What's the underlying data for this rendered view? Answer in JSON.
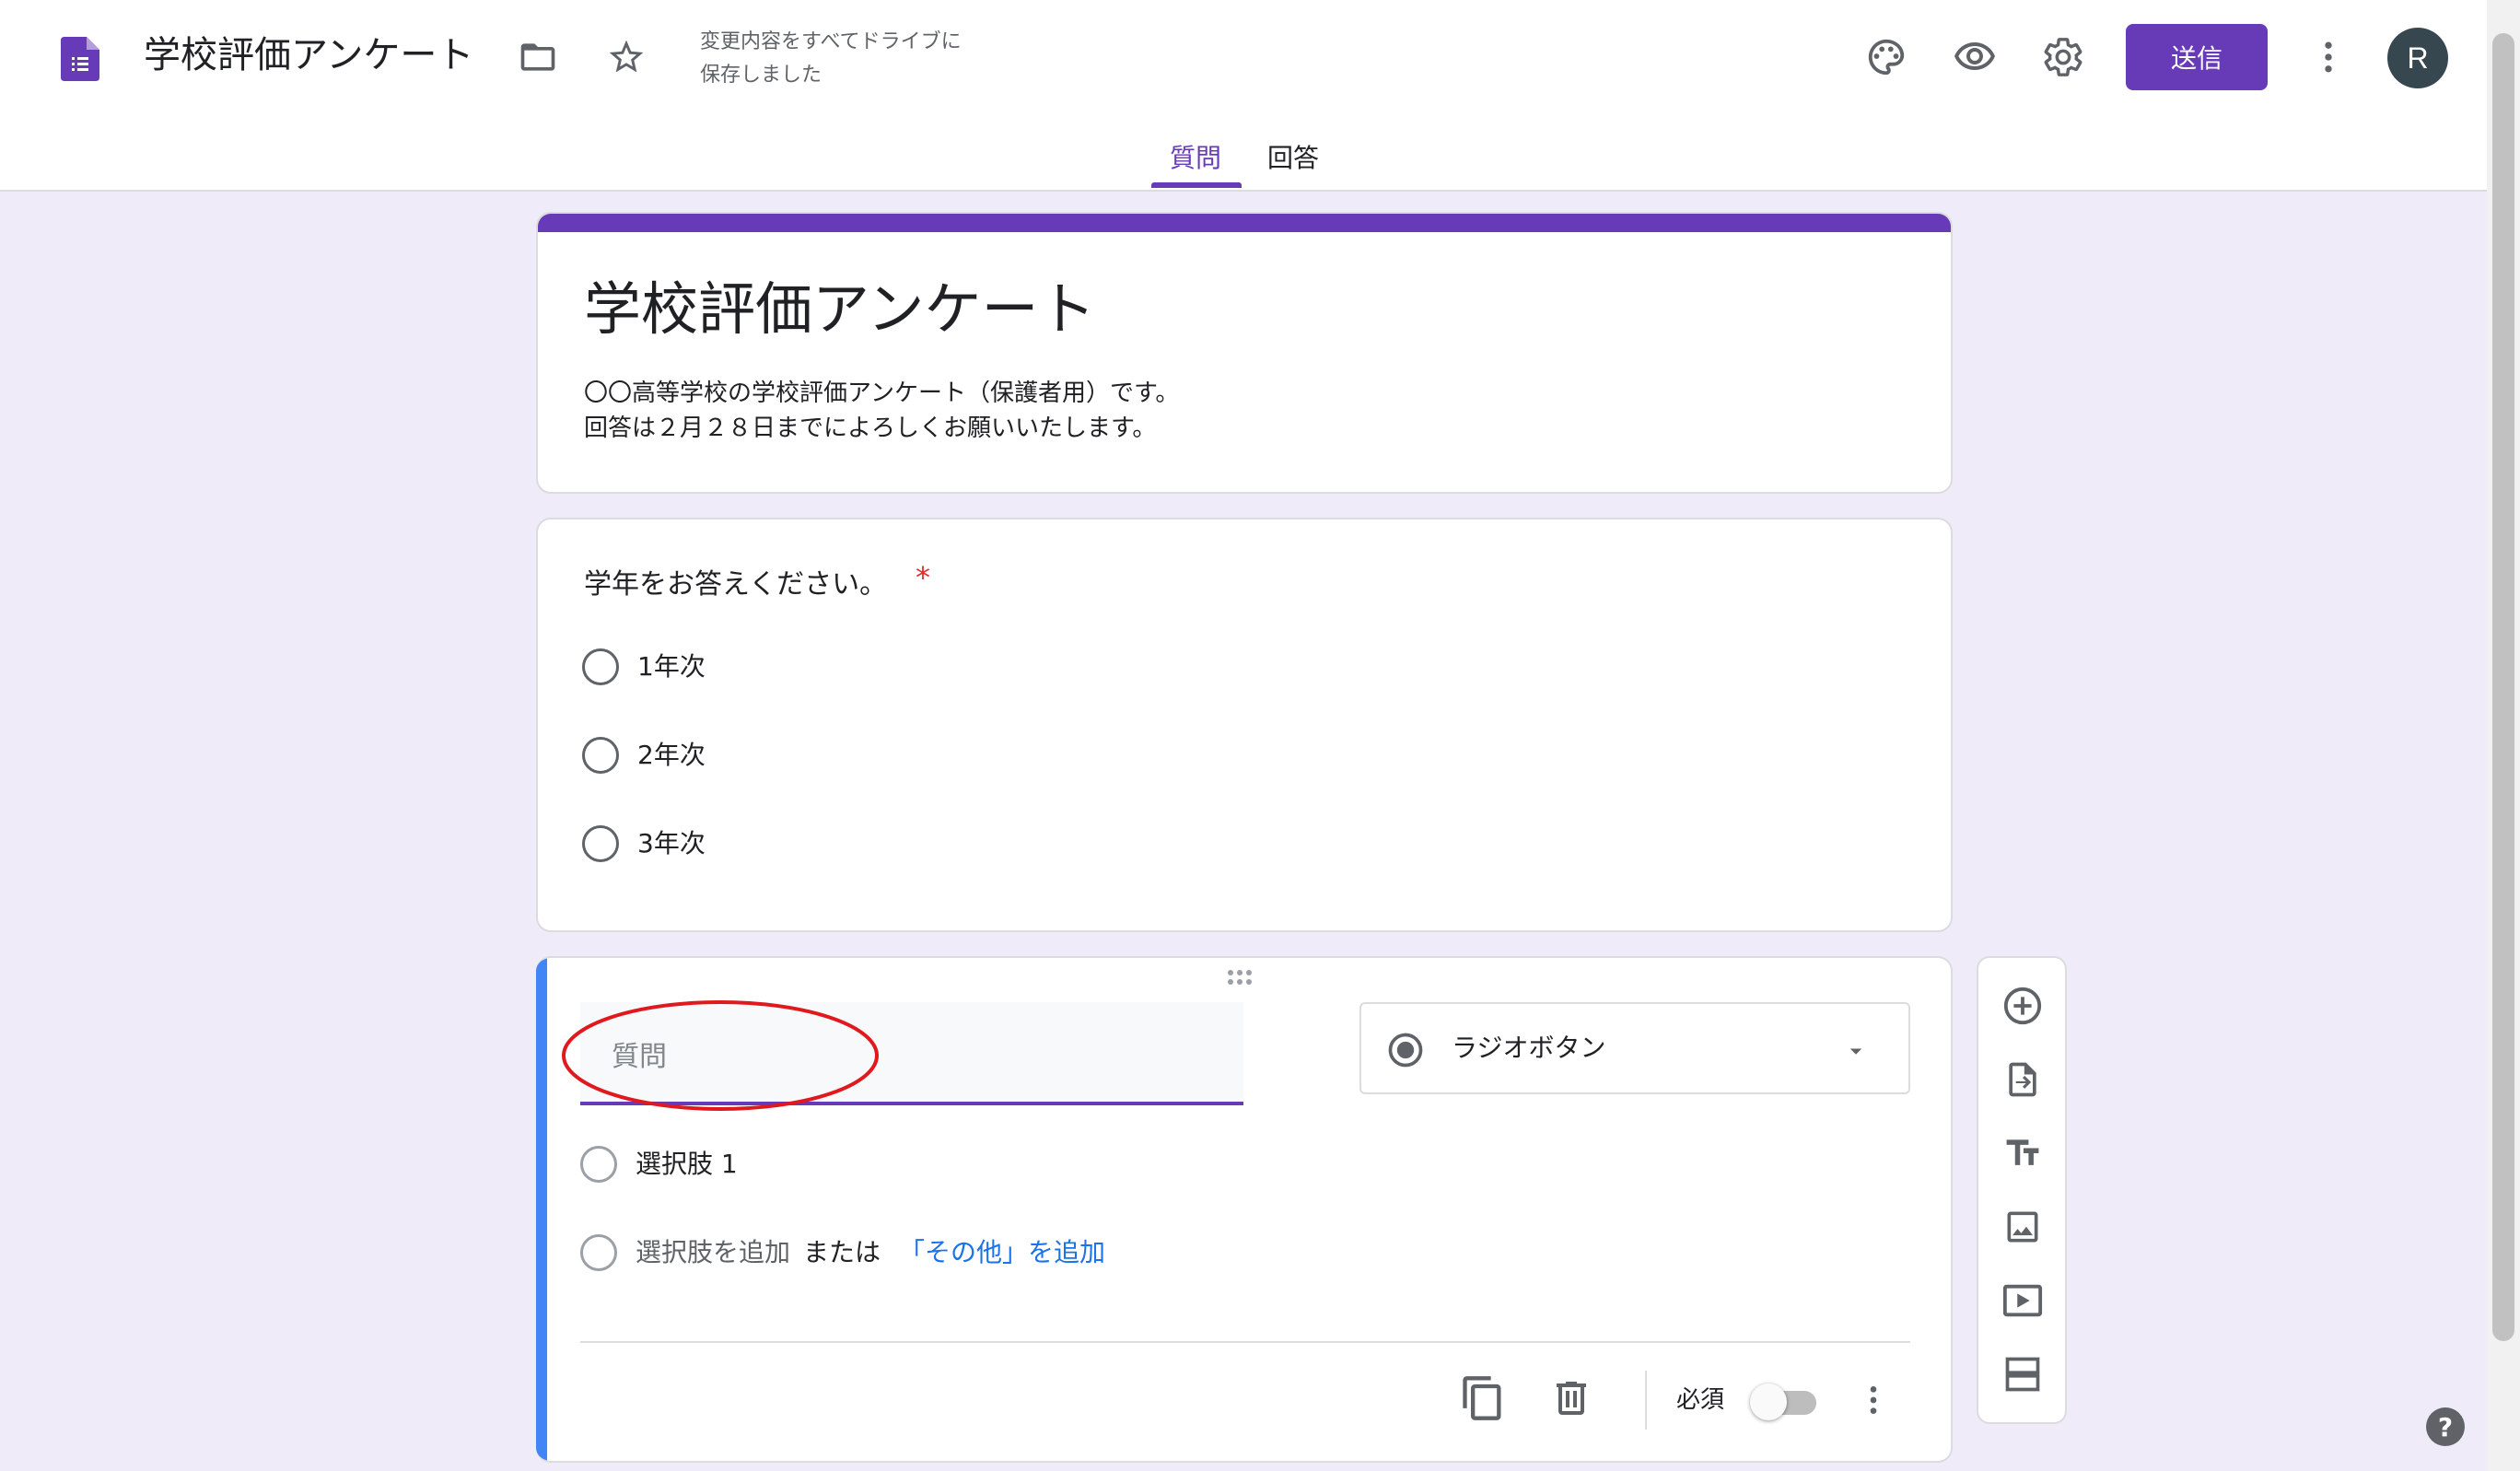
{
  "header": {
    "doc_title": "学校評価アンケート",
    "save_status_line1": "変更内容をすべてドライブに",
    "save_status_line2": "保存しました",
    "send_label": "送信",
    "avatar_letter": "R",
    "icons": [
      "forms-logo-icon",
      "folder-icon",
      "star-icon",
      "palette-icon",
      "eye-icon",
      "gear-icon",
      "more-vert-icon"
    ]
  },
  "tabs": [
    {
      "label": "質問",
      "active": true
    },
    {
      "label": "回答",
      "active": false
    }
  ],
  "form": {
    "title": "学校評価アンケート",
    "description": "〇〇高等学校の学校評価アンケート（保護者用）です。\n回答は２月２８日までによろしくお願いいたします。"
  },
  "question1": {
    "title": "学年をお答えください。",
    "required_mark": "*",
    "options": [
      "1年次",
      "2年次",
      "3年次"
    ]
  },
  "question2": {
    "placeholder": "質問",
    "type_label": "ラジオボタン",
    "option1": "選択肢 1",
    "add_option": "選択肢を追加",
    "or_text": "または",
    "add_other": "「その他」を追加",
    "required_label": "必須",
    "required_on": false
  },
  "side_toolbar": [
    "add-question-icon",
    "import-icon",
    "title-text-icon",
    "image-icon",
    "video-icon",
    "section-icon"
  ],
  "colors": {
    "theme": "#673ab7",
    "background": "#f0ebf8",
    "active_bar": "#4285f4",
    "link": "#1a73e8",
    "annotation": "#e0191e"
  }
}
